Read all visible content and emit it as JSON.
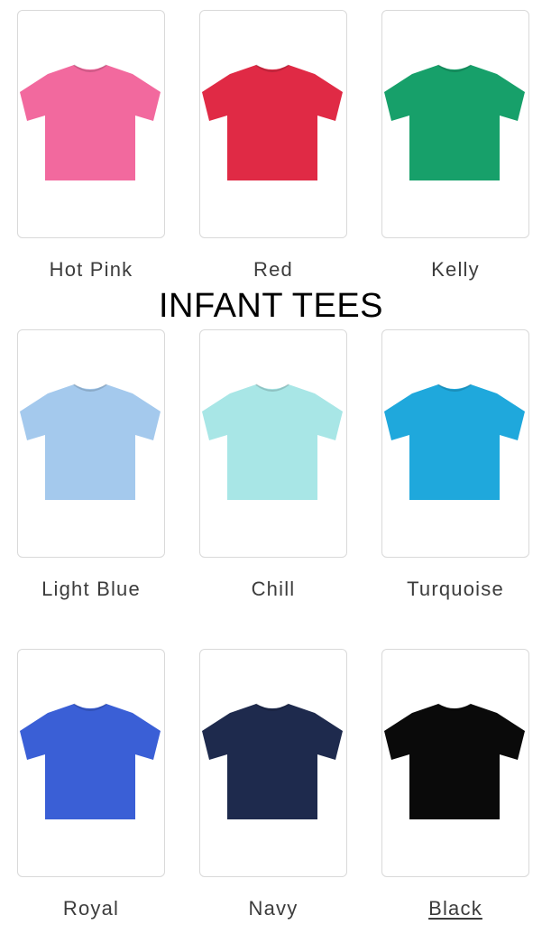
{
  "page_title": "INFANT TEES",
  "swatches": [
    {
      "label": "Hot Pink",
      "color": "#f2699e",
      "selected": false
    },
    {
      "label": "Red",
      "color": "#e02a45",
      "selected": false
    },
    {
      "label": "Kelly",
      "color": "#17a06a",
      "selected": false
    },
    {
      "label": "Light Blue",
      "color": "#a4c9ed",
      "selected": false
    },
    {
      "label": "Chill",
      "color": "#a8e6e6",
      "selected": false
    },
    {
      "label": "Turquoise",
      "color": "#1fa8dc",
      "selected": false
    },
    {
      "label": "Royal",
      "color": "#3a5fd6",
      "selected": false
    },
    {
      "label": "Navy",
      "color": "#1e2a4d",
      "selected": false
    },
    {
      "label": "Black",
      "color": "#0a0a0a",
      "selected": true
    }
  ]
}
